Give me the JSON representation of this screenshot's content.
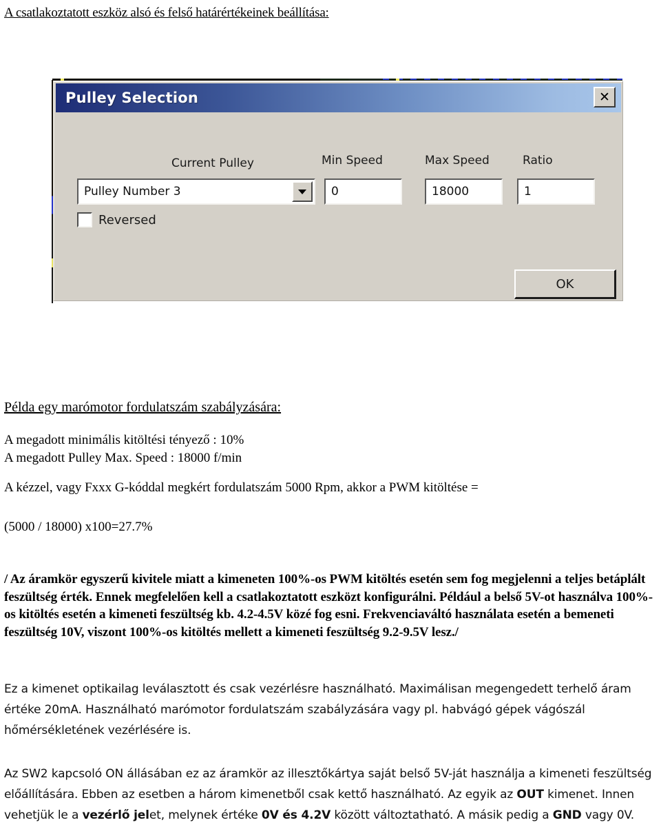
{
  "headline": "A csatlakoztatott eszköz alsó és felső határértékeinek beállítása:",
  "dialog": {
    "title": "Pulley Selection",
    "close_label": "✕",
    "close_icon": "close-icon",
    "labels": {
      "current_pulley": "Current Pulley",
      "min_speed": "Min Speed",
      "max_speed": "Max Speed",
      "ratio": "Ratio"
    },
    "values": {
      "current_pulley": "Pulley Number 3",
      "min_speed": "0",
      "max_speed": "18000",
      "ratio": "1"
    },
    "checkbox": {
      "label": "Reversed",
      "checked": false
    },
    "ok_label": "OK",
    "colors": {
      "face": "#d4d0c8",
      "title_left": "#1d2d77",
      "title_right": "#a8c6ea",
      "field_bg": "#ffffff"
    }
  },
  "body": {
    "example_heading": "Példa egy marómotor fordulatszám szabályzására:",
    "given_line_1": "A megadott minimális kitöltési tényező : 10%",
    "given_line_2": "A megadott Pulley Max. Speed : 18000 f/min",
    "calc_line": "A kézzel, vagy Fxxx G-kóddal megkért fordulatszám 5000 Rpm, akkor a PWM kitöltése =",
    "result_line": "(5000 / 18000) x100=27.7%",
    "bold_note": "/ Az áramkör egyszerű kivitele miatt a kimeneten 100%-os PWM kitöltés esetén sem fog megjelenni a teljes betáplált feszültség érték. Ennek megfelelően kell a csatlakoztatott eszközt konfigurálni. Például a belső 5V-ot használva 100%-os kitöltés esetén a kimeneti feszültség kb. 4.2-4.5V közé fog esni. Frekvenciaváltó használata esetén a bemeneti feszültség 10V, viszont 100%-os kitöltés mellett a kimeneti feszültség 9.2-9.5V lesz./",
    "opto_note": "Ez a kimenet optikailag leválasztott és csak vezérlésre használható. Maximálisan megengedett terhelő áram értéke 20mA. Használható marómotor fordulatszám szabályzására vagy pl. habvágó gépek vágószál hőmérsékletének vezérlésére is.",
    "sw2_note": {
      "part_1": "Az SW2 kapcsoló ON állásában ez az áramkör az illesztőkártya saját belső 5V-ját használja a kimeneti feszültség előállítására. Ebben az esetben a három kimenetből csak kettő használható. Az egyik az ",
      "bold_1": "OUT",
      "part_2": " kimenet. Innen vehetjük le a ",
      "bold_2": "vezérlő jel",
      "part_3": "et, melynek értéke ",
      "bold_3": "0V és 4.2V",
      "part_4": " között változtatható. A másik pedig a ",
      "bold_4": "GND",
      "part_5": " vagy 0V."
    }
  }
}
